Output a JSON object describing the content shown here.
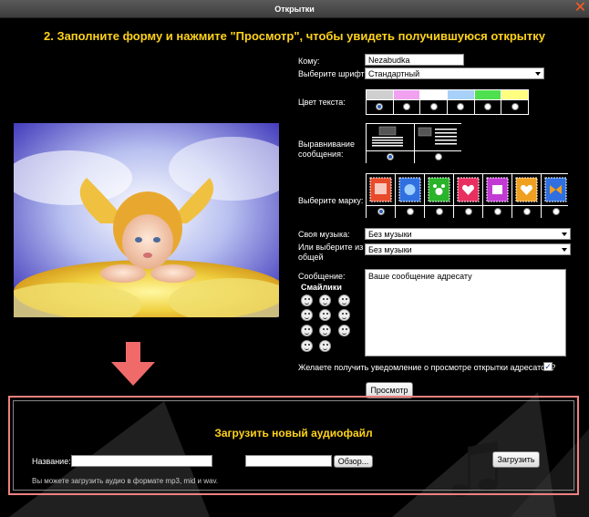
{
  "window": {
    "title": "Открытки"
  },
  "heading": "2. Заполните форму и нажмите \"Просмотр\", чтобы увидеть получившуюся открытку",
  "form": {
    "to_label": "Кому:",
    "to_value": "Nezabudka",
    "font_label": "Выберите шрифт:",
    "font_value": "Стандартный",
    "color_label": "Цвет текста:",
    "colors": [
      "#cfcfcf",
      "#f0a2f0",
      "#ffffff",
      "#a8d0f8",
      "#4fe04f",
      "#ffff80"
    ],
    "align_label": "Выравнивание сообщения:",
    "stamp_label": "Выберите марку:",
    "stamps": [
      "#e84b2a",
      "#2f6fe0",
      "#29b429",
      "#e83060",
      "#c23ad4",
      "#f0a020",
      "#2f6fe0"
    ],
    "music_label": "Своя музыка:",
    "music_value": "Без музыки",
    "music2_label": "Или выберите из общей",
    "music2_value": "Без музыки",
    "message_label": "Сообщение:",
    "smileys_label": "Смайлики",
    "message_value": "Ваше сообщение адресату",
    "notify_label": "Желаете получить уведомление о просмотре открытки адресатом?",
    "notify_check": "✓",
    "preview_button": "Просмотр"
  },
  "upload": {
    "title": "Загрузить новый аудиофайл",
    "name_label": "Название:",
    "browse_button": "Обзор...",
    "upload_button": "Загрузить",
    "hint": "Вы можете загрузить аудио в формате mp3, mid и wav."
  },
  "icons": {
    "close": "close-icon",
    "arrow": "arrow-down-icon"
  }
}
